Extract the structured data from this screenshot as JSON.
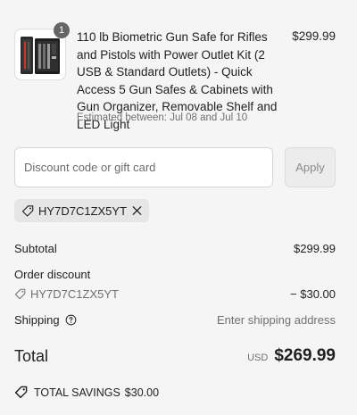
{
  "line_item": {
    "quantity": "1",
    "title": "110 lb Biometric Gun Safe for Rifles and Pistols with Power Outlet Kit (2 USB & Standard Outlets) - Quick Access 5 Gun Safes & Cabinets with Gun Organizer, Removable Shelf and LED Light",
    "estimated_delivery": "Estimated between: Jul 08 and Jul 10",
    "price": "$299.99"
  },
  "discount": {
    "placeholder": "Discount code or gift card",
    "value": "",
    "apply_label": "Apply",
    "applied_code": "HY7D7C1ZX5YT"
  },
  "summary": {
    "subtotal_label": "Subtotal",
    "subtotal_value": "$299.99",
    "order_discount_label": "Order discount",
    "order_discount_code": "HY7D7C1ZX5YT",
    "order_discount_value": "− $30.00",
    "shipping_label": "Shipping",
    "shipping_value": "Enter shipping address",
    "total_label": "Total",
    "total_currency": "USD",
    "total_value": "$269.99",
    "savings_label": "TOTAL SAVINGS",
    "savings_value": "$30.00"
  },
  "icons": {
    "tag": "tag-icon",
    "close": "close-icon",
    "help": "help-circle-icon"
  }
}
